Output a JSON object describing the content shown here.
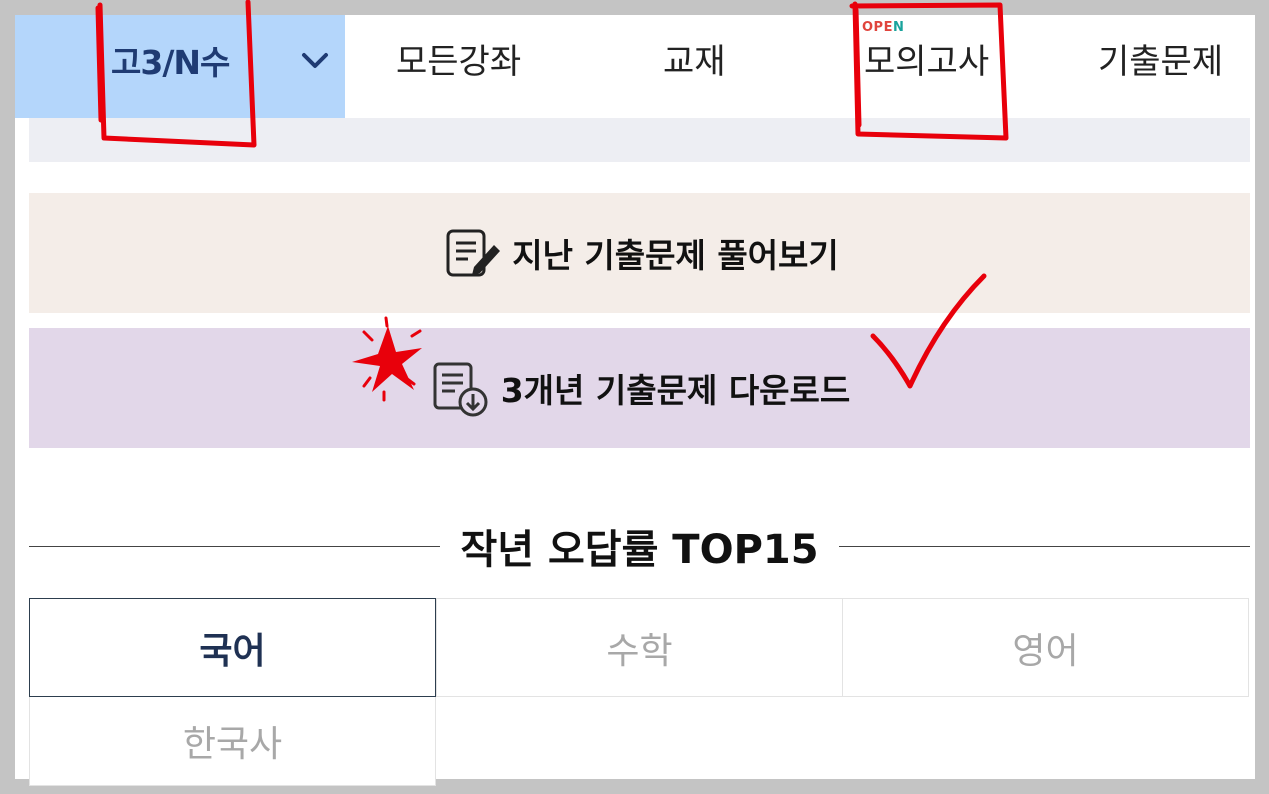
{
  "nav": {
    "grade": "고3/N수",
    "items": [
      "모든강좌",
      "교재",
      "모의고사",
      "기출문제"
    ],
    "badge": {
      "text": "OPEN",
      "colors": [
        "#e0443c",
        "#19a39c"
      ]
    }
  },
  "actions": {
    "past_label": "지난 기출문제 풀어보기",
    "download_label": "3개년 기출문제 다운로드"
  },
  "section": {
    "title": "작년 오답률 TOP15"
  },
  "tabs": [
    {
      "label": "국어",
      "active": true
    },
    {
      "label": "수학",
      "active": false
    },
    {
      "label": "영어",
      "active": false
    },
    {
      "label": "한국사",
      "active": false
    }
  ],
  "colors": {
    "grade_box": "#b4d6fb",
    "past_bg": "#f4ede8",
    "download_bg": "#e2d7e9",
    "annotation": "#e8000b"
  },
  "icons": [
    "chevron-down-icon",
    "edit-document-icon",
    "download-document-icon"
  ]
}
